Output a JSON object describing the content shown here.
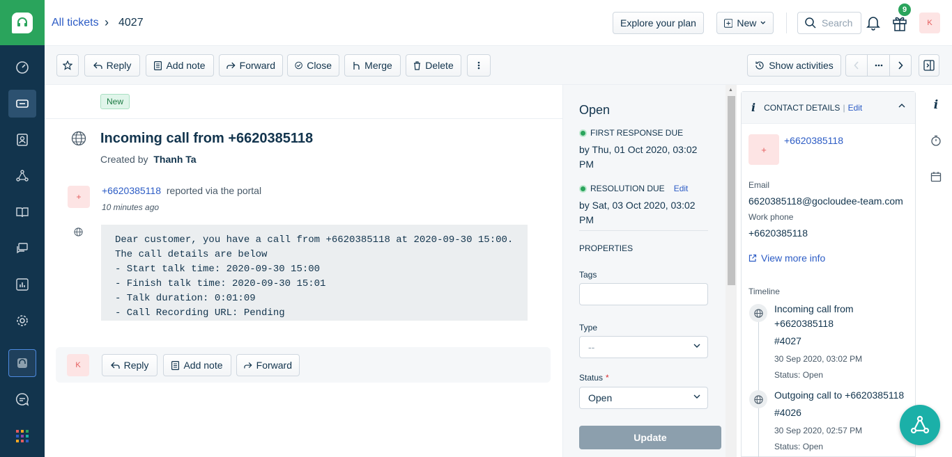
{
  "header": {
    "breadcrumb_link": "All tickets",
    "ticket_id": "4027",
    "explore_plan": "Explore your plan",
    "new_button": "New",
    "search_placeholder": "Search",
    "gift_badge": "9",
    "avatar_initial": "K"
  },
  "toolbar": {
    "reply": "Reply",
    "add_note": "Add note",
    "forward": "Forward",
    "close": "Close",
    "merge": "Merge",
    "delete": "Delete",
    "show_activities": "Show activities"
  },
  "ticket": {
    "status_badge": "New",
    "title": "Incoming call from +6620385118",
    "created_by_label": "Created by",
    "created_by_name": "Thanh Ta",
    "requester_initial": "+",
    "requester": "+6620385118",
    "reported_via": "reported via the portal",
    "time_ago": "10 minutes ago",
    "message": "Dear customer, you have a call from +6620385118 at 2020-09-30 15:00. The call details are below\n- Start talk time: 2020-09-30 15:00\n- Finish talk time: 2020-09-30 15:01\n- Talk duration: 0:01:09\n- Call Recording URL: Pending"
  },
  "reply_bar": {
    "avatar_initial": "K",
    "reply": "Reply",
    "add_note": "Add note",
    "forward": "Forward"
  },
  "properties": {
    "status_title": "Open",
    "first_response_label": "FIRST RESPONSE DUE",
    "first_response_value": "by Thu, 01 Oct 2020, 03:02 PM",
    "resolution_label": "RESOLUTION DUE",
    "resolution_edit": "Edit",
    "resolution_value": "by Sat, 03 Oct 2020, 03:02 PM",
    "section_title": "PROPERTIES",
    "tags_label": "Tags",
    "type_label": "Type",
    "type_value": "--",
    "status_label": "Status",
    "status_required": "*",
    "status_value": "Open",
    "update_button": "Update"
  },
  "contact": {
    "header": "CONTACT DETAILS",
    "header_sep": "|",
    "edit": "Edit",
    "avatar_initial": "+",
    "phone_link": "+6620385118",
    "email_label": "Email",
    "email_value": "6620385118@gocloudee-team.com",
    "work_phone_label": "Work phone",
    "work_phone_value": "+6620385118",
    "view_more": "View more info",
    "timeline_label": "Timeline",
    "timeline": [
      {
        "title": "Incoming call from +6620385118",
        "id": "#4027",
        "date": "30 Sep 2020, 03:02 PM",
        "status": "Status: Open"
      },
      {
        "title": "Outgoing call to +6620385118",
        "id": "#4026",
        "date": "30 Sep 2020, 02:57 PM",
        "status": "Status: Open"
      }
    ]
  },
  "colors": {
    "sidebar_bg": "#12344d",
    "brand_green": "#2aa45c",
    "link_blue": "#2c5cc5",
    "fab_teal": "#1bb0a8"
  }
}
